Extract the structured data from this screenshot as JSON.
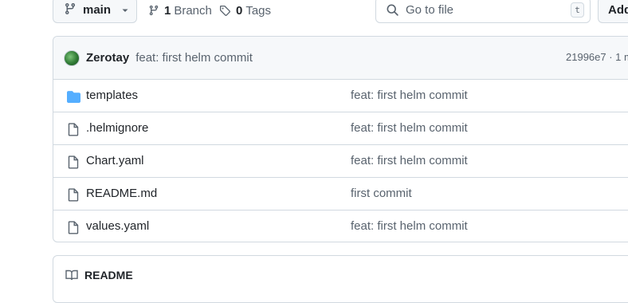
{
  "toolbar": {
    "branch_label": "main",
    "branches_count": "1",
    "branches_label": "Branch",
    "tags_count": "0",
    "tags_label": "Tags",
    "go_to_file_placeholder": "Go to file",
    "go_to_file_shortcut": "t",
    "add_file_label": "Add"
  },
  "latest_commit": {
    "author": "Zerotay",
    "message": "feat: first helm commit",
    "hash_and_time": "21996e7 · 1 m"
  },
  "files": [
    {
      "type": "directory",
      "icon": "folder-icon",
      "name": "templates",
      "commit_message": "feat: first helm commit"
    },
    {
      "type": "file",
      "icon": "file-icon",
      "name": ".helmignore",
      "commit_message": "feat: first helm commit"
    },
    {
      "type": "file",
      "icon": "file-icon",
      "name": "Chart.yaml",
      "commit_message": "feat: first helm commit"
    },
    {
      "type": "file",
      "icon": "file-icon",
      "name": "README.md",
      "commit_message": "first commit"
    },
    {
      "type": "file",
      "icon": "file-icon",
      "name": "values.yaml",
      "commit_message": "feat: first helm commit"
    }
  ],
  "readme": {
    "title": "README"
  },
  "colors": {
    "folder": "#54aeff",
    "border": "#d1d9e0",
    "muted_text": "#59636e",
    "header_bg": "#f6f8fa"
  }
}
